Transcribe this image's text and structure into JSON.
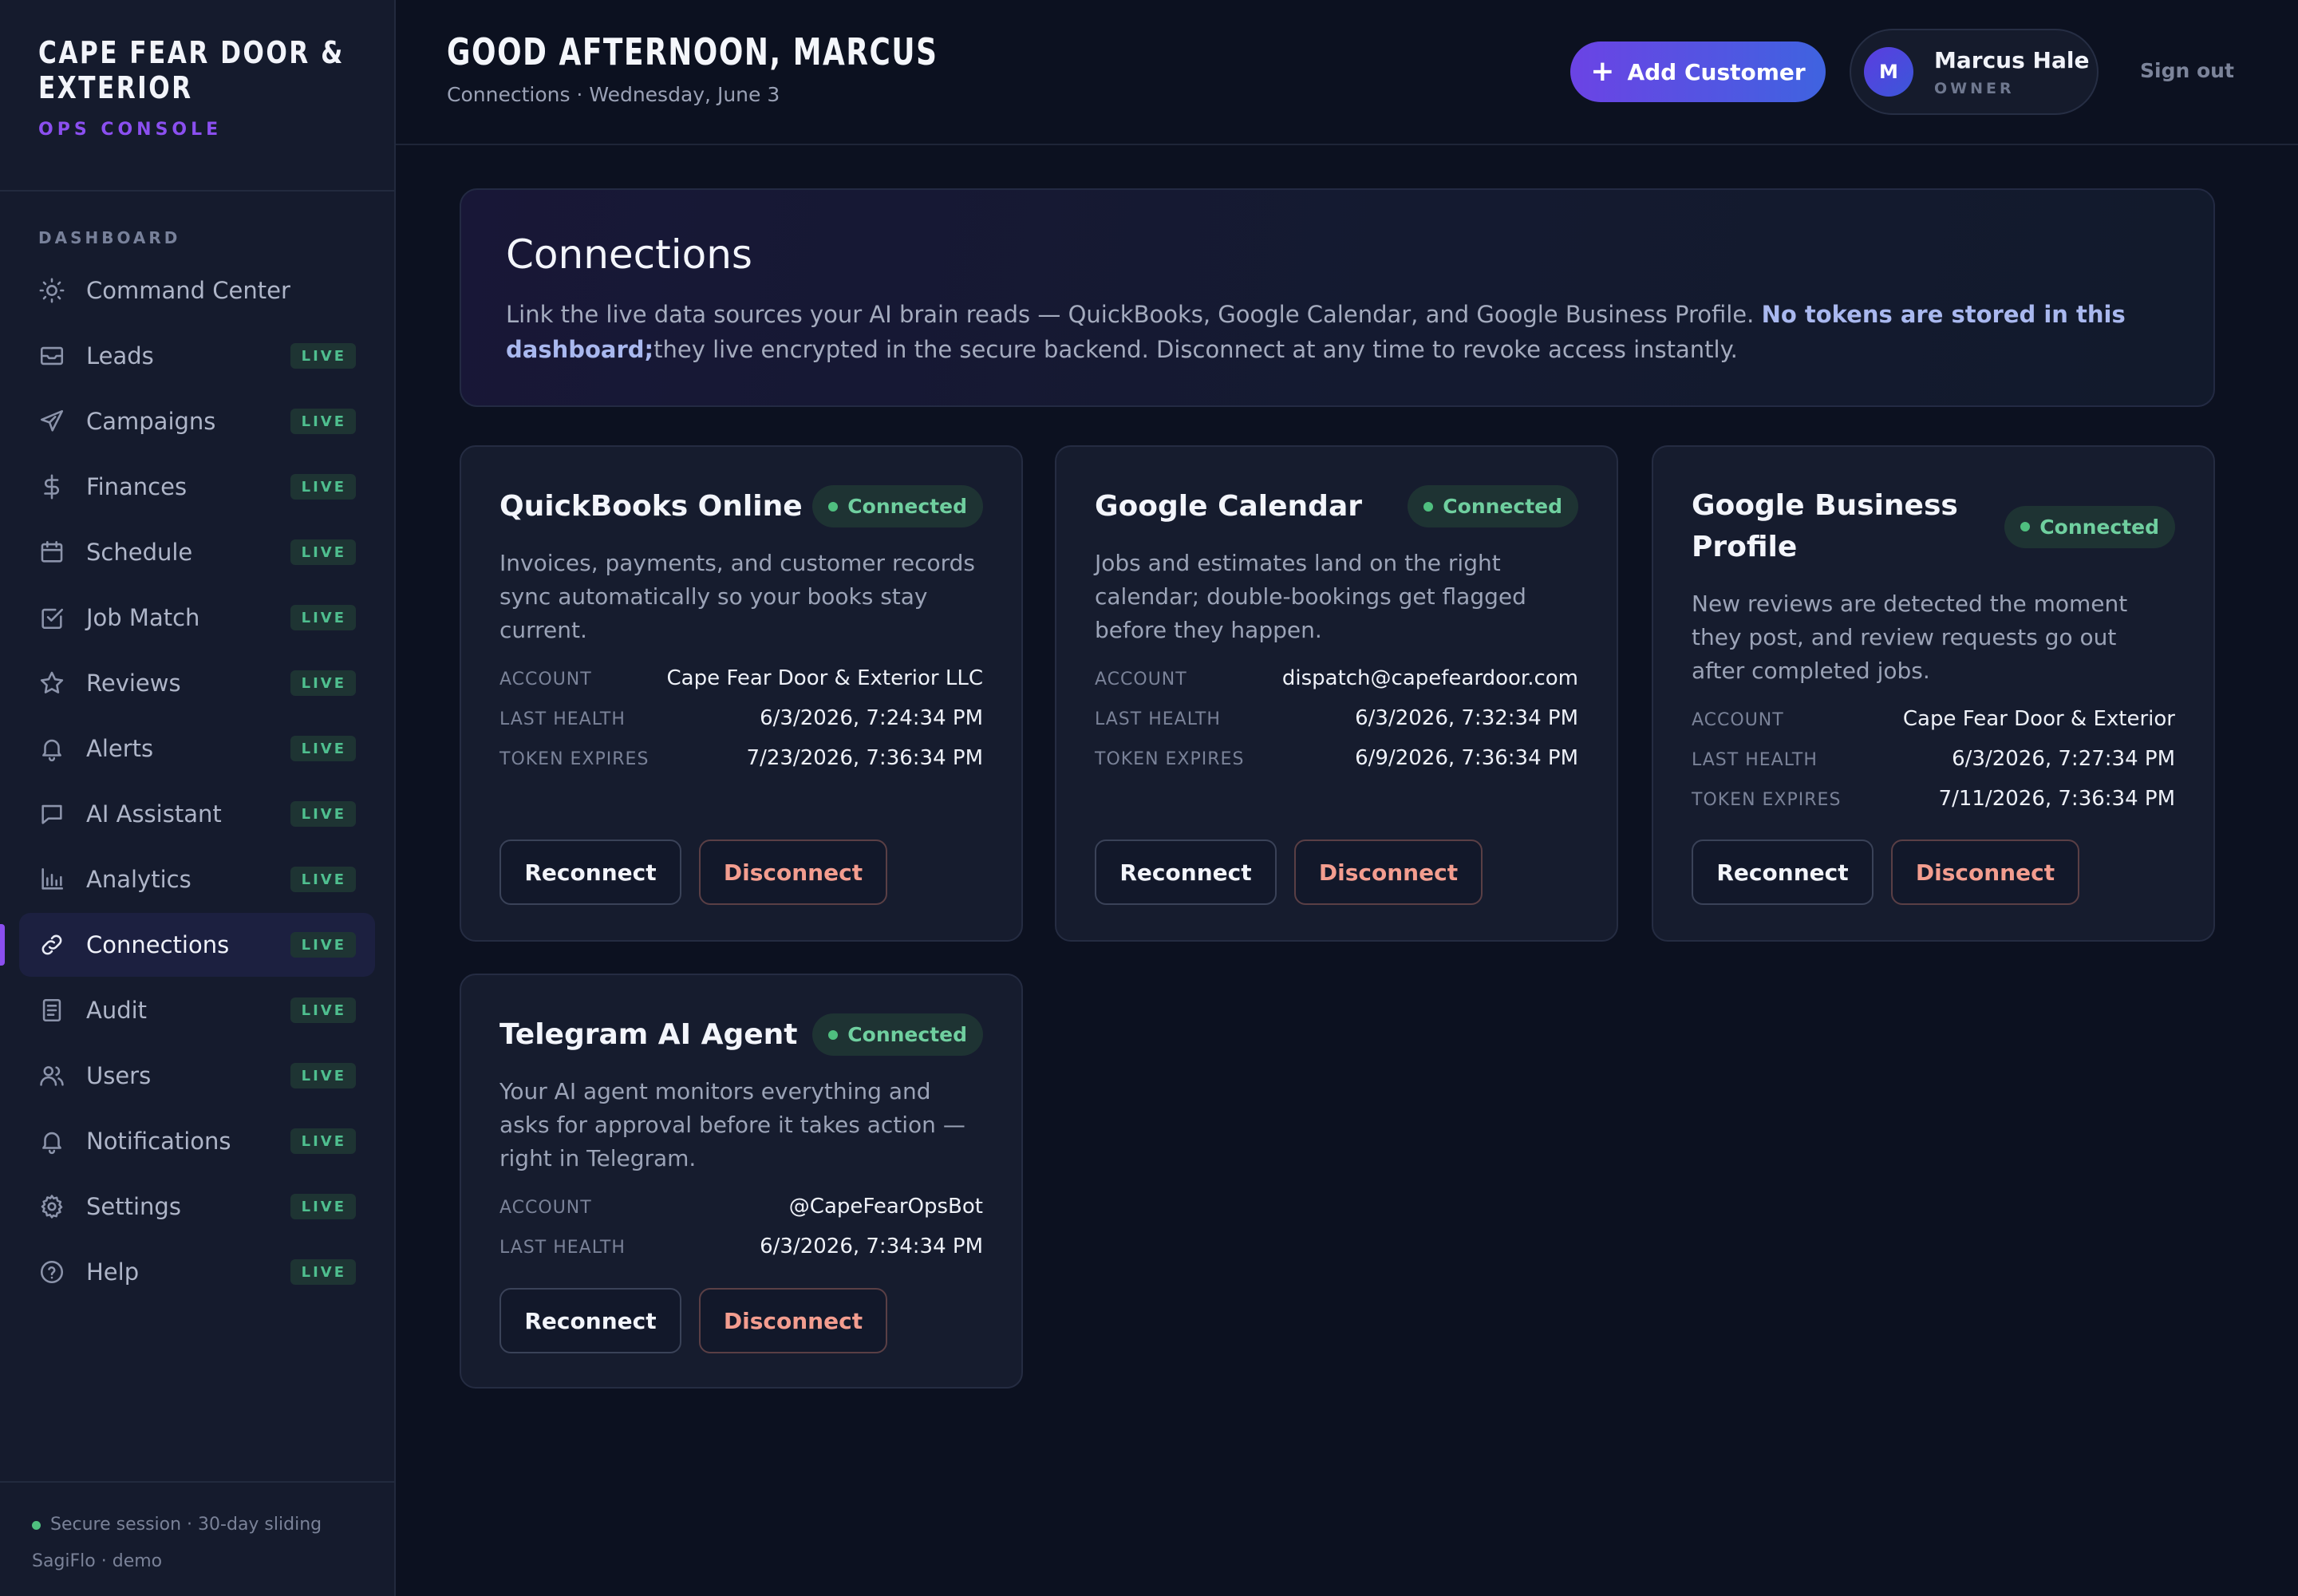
{
  "brand": {
    "name_line1": "CAPE FEAR DOOR &",
    "name_line2": "EXTERIOR",
    "subtitle": "OPS CONSOLE"
  },
  "sidebar": {
    "section_label": "DASHBOARD",
    "items": [
      {
        "label": "Command Center",
        "icon": "sun-icon",
        "badge": ""
      },
      {
        "label": "Leads",
        "icon": "inbox-icon",
        "badge": "LIVE"
      },
      {
        "label": "Campaigns",
        "icon": "send-icon",
        "badge": "LIVE"
      },
      {
        "label": "Finances",
        "icon": "dollar-icon",
        "badge": "LIVE"
      },
      {
        "label": "Schedule",
        "icon": "calendar-icon",
        "badge": "LIVE"
      },
      {
        "label": "Job Match",
        "icon": "checkbox-icon",
        "badge": "LIVE"
      },
      {
        "label": "Reviews",
        "icon": "star-icon",
        "badge": "LIVE"
      },
      {
        "label": "Alerts",
        "icon": "bell-icon",
        "badge": "LIVE"
      },
      {
        "label": "AI Assistant",
        "icon": "chat-icon",
        "badge": "LIVE"
      },
      {
        "label": "Analytics",
        "icon": "bar-chart-icon",
        "badge": "LIVE"
      },
      {
        "label": "Connections",
        "icon": "link-icon",
        "badge": "LIVE",
        "active": true
      },
      {
        "label": "Audit",
        "icon": "document-icon",
        "badge": "LIVE"
      },
      {
        "label": "Users",
        "icon": "users-icon",
        "badge": "LIVE"
      },
      {
        "label": "Notifications",
        "icon": "bell-icon",
        "badge": "LIVE"
      },
      {
        "label": "Settings",
        "icon": "gear-icon",
        "badge": "LIVE"
      },
      {
        "label": "Help",
        "icon": "help-circle-icon",
        "badge": "LIVE"
      }
    ],
    "footer": {
      "session": "Secure session · 30-day sliding",
      "credit": "SagiFlo · demo"
    }
  },
  "header": {
    "greeting": "GOOD AFTERNOON, MARCUS",
    "subline": "Connections · Wednesday, June 3",
    "add_button": "Add Customer",
    "user": {
      "initial": "M",
      "name": "Marcus Hale",
      "role": "OWNER"
    },
    "sign_out": "Sign out"
  },
  "intro": {
    "title": "Connections",
    "text": "Link the live data sources your AI brain reads — QuickBooks, Google Calendar, and Google Business Profile. ",
    "emphasis": "No tokens are stored in this dashboard;",
    "text_after": "they live encrypted in the secure backend. Disconnect at any time to revoke access instantly."
  },
  "cards": [
    {
      "title": "QuickBooks Online",
      "status": "Connected",
      "description": "Invoices, payments, and customer records sync automatically so your books stay current.",
      "fields": [
        {
          "key": "ACCOUNT",
          "value": "Cape Fear Door & Exterior LLC"
        },
        {
          "key": "LAST HEALTH",
          "value": "6/3/2026, 7:24:34 PM"
        },
        {
          "key": "TOKEN EXPIRES",
          "value": "7/23/2026, 7:36:34 PM"
        }
      ],
      "reconnect": "Reconnect",
      "disconnect": "Disconnect"
    },
    {
      "title": "Google Calendar",
      "status": "Connected",
      "description": "Jobs and estimates land on the right calendar; double-bookings get flagged before they happen.",
      "fields": [
        {
          "key": "ACCOUNT",
          "value": "dispatch@capefeardoor.com"
        },
        {
          "key": "LAST HEALTH",
          "value": "6/3/2026, 7:32:34 PM"
        },
        {
          "key": "TOKEN EXPIRES",
          "value": "6/9/2026, 7:36:34 PM"
        }
      ],
      "reconnect": "Reconnect",
      "disconnect": "Disconnect"
    },
    {
      "title": "Google Business Profile",
      "status": "Connected",
      "description": "New reviews are detected the moment they post, and review requests go out after completed jobs.",
      "fields": [
        {
          "key": "ACCOUNT",
          "value": "Cape Fear Door & Exterior"
        },
        {
          "key": "LAST HEALTH",
          "value": "6/3/2026, 7:27:34 PM"
        },
        {
          "key": "TOKEN EXPIRES",
          "value": "7/11/2026, 7:36:34 PM"
        }
      ],
      "reconnect": "Reconnect",
      "disconnect": "Disconnect"
    },
    {
      "title": "Telegram AI Agent",
      "status": "Connected",
      "description": "Your AI agent monitors everything and asks for approval before it takes action — right in Telegram.",
      "fields": [
        {
          "key": "ACCOUNT",
          "value": "@CapeFearOpsBot"
        },
        {
          "key": "LAST HEALTH",
          "value": "6/3/2026, 7:34:34 PM"
        }
      ],
      "reconnect": "Reconnect",
      "disconnect": "Disconnect"
    }
  ],
  "colors": {
    "accent": "#8b4ff0",
    "connected": "#6fcf9f",
    "disconnect": "#f39d8f",
    "background": "#0c1120"
  }
}
